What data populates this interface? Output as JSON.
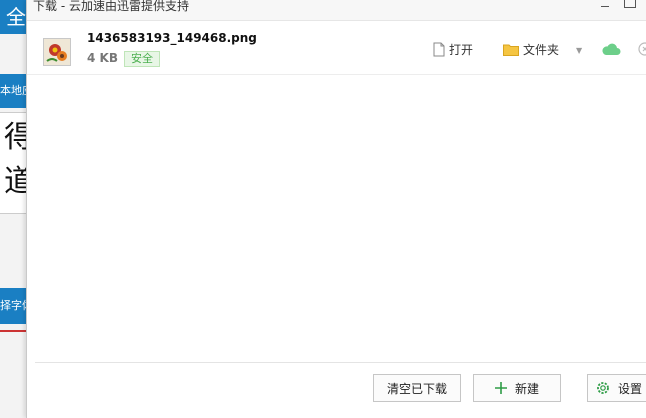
{
  "background": {
    "top_char": "全",
    "tab1_label": "本地应",
    "chars": [
      "得",
      "道"
    ],
    "tab2_label": "择字体"
  },
  "dialog": {
    "title": "下载 - 云加速由迅雷提供支持"
  },
  "file": {
    "name": "1436583193_149468.png",
    "size": "4 KB",
    "badge": "安全"
  },
  "actions": {
    "open_label": "打开",
    "folder_label": "文件夹"
  },
  "footer": {
    "clear_label": "清空已下载",
    "new_label": "新建",
    "settings_label": "设置"
  },
  "colors": {
    "accent_blue": "#1a7fc3",
    "safe_green": "#4caf50",
    "folder_yellow": "#f5c542",
    "cloud_green": "#6dcf8a"
  }
}
